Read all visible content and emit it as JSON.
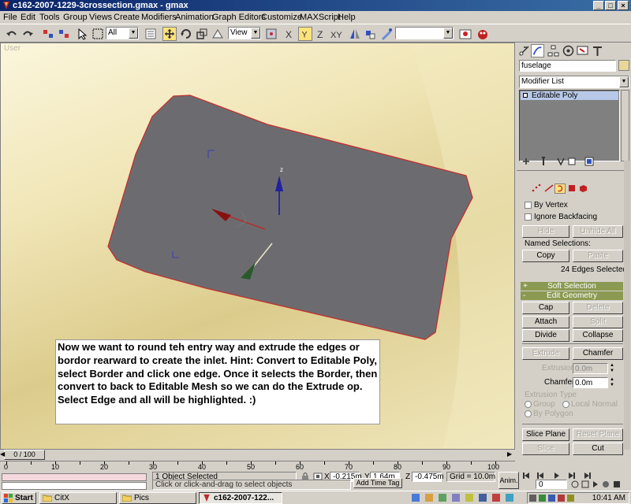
{
  "window": {
    "title": "c162-2007-1229-3crossection.gmax - gmax",
    "min": "_",
    "max": "□",
    "close": "×"
  },
  "menu": [
    "File",
    "Edit",
    "Tools",
    "Group",
    "Views",
    "Create",
    "Modifiers",
    "Animation",
    "Graph Editors",
    "Customize",
    "MAXScript",
    "Help"
  ],
  "toolbar": {
    "selection_filter": "All",
    "ref_coord": "View",
    "named_set": ""
  },
  "viewport": {
    "label": "User",
    "axis_z": "z",
    "note": "Now we want to round teh entry way and extrude the edges or bordor rearward to create the inlet.  Hint: Convert to Editable Poly, select Border and click one edge.  Once it selects the Border, then convert to back to Editable Mesh so we can do the Extrude op.  Select Edge and all will be highlighted. :)"
  },
  "panel": {
    "object_name": "fuselage",
    "modifier_list": "Modifier List",
    "stack_item": "Editable Poly",
    "by_vertex": "By Vertex",
    "ignore_backfacing": "Ignore Backfacing",
    "hide": "Hide",
    "unhide_all": "Unhide All",
    "named_selections": "Named Selections:",
    "copy": "Copy",
    "paste": "Paste",
    "edges_selected": "24 Edges Selected",
    "soft_selection": "Soft Selection",
    "edit_geometry": "Edit Geometry",
    "plus": "+",
    "minus": "-",
    "cap": "Cap",
    "delete": "Delete",
    "attach": "Attach",
    "split": "Split",
    "divide": "Divide",
    "collapse": "Collapse",
    "extrude": "Extrude",
    "chamfer": "Chamfer",
    "extrusion_label": "Extrusion",
    "extrusion_value": "0.0m",
    "chamfer_label": "Chamfer",
    "chamfer_value": "0.0m",
    "extrusion_type": "Extrusion Type",
    "group": "Group",
    "local_normal": "Local Normal",
    "by_polygon": "By Polygon",
    "slice_plane": "Slice Plane",
    "reset_plane": "Reset Plane",
    "slice": "Slice",
    "cut": "Cut"
  },
  "timeline": {
    "frame": "0 / 100",
    "ticks": [
      "0",
      "10",
      "20",
      "30",
      "40",
      "50",
      "60",
      "70",
      "80",
      "90",
      "100"
    ]
  },
  "status": {
    "objects_selected": "1 Object Selected",
    "prompt": "Click or click-and-drag to select objects",
    "x_label": "X",
    "x": "-0.215m",
    "y_label": "Y",
    "y": "1.64m",
    "z_label": "Z",
    "z": "-0.475m",
    "grid": "Grid = 10.0m",
    "add_time_tag": "Add Time Tag",
    "anim": "Anim.",
    "frame_field": "0"
  },
  "taskbar": {
    "start": "Start",
    "tasks": [
      "CitX",
      "Pics",
      "c162-2007-122..."
    ],
    "clock": "10:41 AM"
  },
  "colors": {
    "title_start": "#0a246a",
    "title_end": "#3a6ea5",
    "object_gray": "#6c6c70",
    "edge_red": "#c03030",
    "rollout_green": "#8a9a52",
    "active_yellow": "#ffe27a"
  }
}
